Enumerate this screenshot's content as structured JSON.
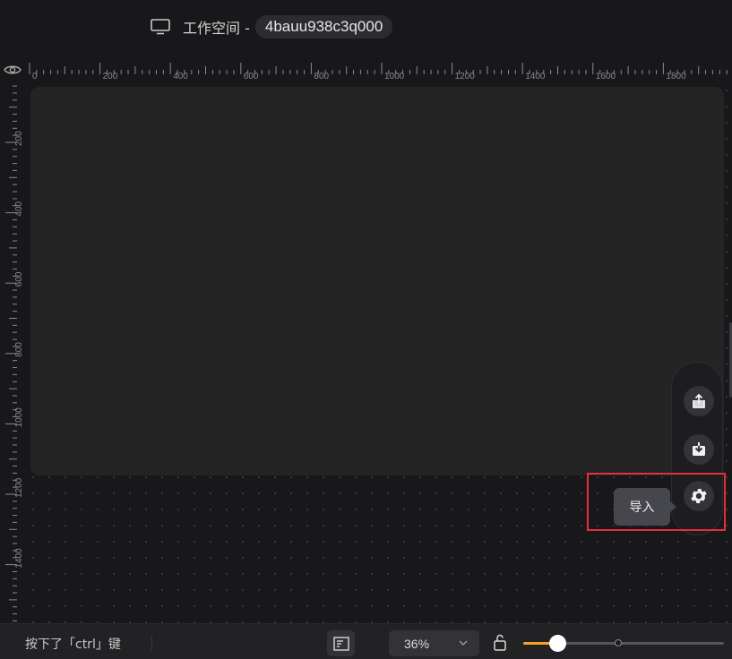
{
  "header": {
    "workspace_label": "工作空间 -",
    "workspace_id": "4bauu938c3q000"
  },
  "ruler": {
    "top_ticks": [
      "0",
      "200",
      "400",
      "600",
      "800",
      "1000",
      "1200",
      "1400",
      "1600",
      "1800"
    ],
    "left_ticks": [
      "200",
      "400",
      "600",
      "800",
      "1000",
      "1200",
      "1400"
    ]
  },
  "toolbar": {
    "export_icon": "export-icon",
    "import_icon": "import-icon",
    "settings_icon": "gear-icon",
    "tooltip": "导入"
  },
  "status_bar": {
    "message": "按下了「ctrl」键",
    "zoom_value": "36%",
    "zoom_slider_fraction": 0.17
  },
  "colors": {
    "accent": "#f5a623",
    "highlight": "#e0303a"
  }
}
